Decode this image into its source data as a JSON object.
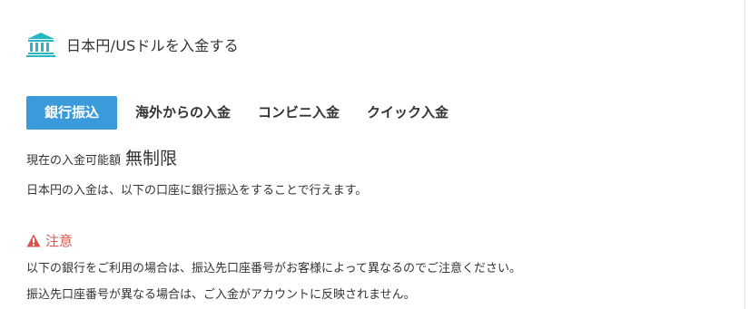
{
  "header": {
    "icon": "bank-icon",
    "icon_color": "#25b8c2",
    "title": "日本円/USドルを入金する"
  },
  "tabs": [
    {
      "label": "銀行振込",
      "active": true
    },
    {
      "label": "海外からの入金",
      "active": false
    },
    {
      "label": "コンビニ入金",
      "active": false
    },
    {
      "label": "クイック入金",
      "active": false
    }
  ],
  "accent_color": "#3b9ad9",
  "deposit_limit": {
    "label": "現在の入金可能額",
    "value": "無制限"
  },
  "info": {
    "text": "日本円の入金は、以下の口座に銀行振込をすることで行えます。"
  },
  "notice": {
    "icon": "warning-icon",
    "color": "#d9534f",
    "heading": "注意",
    "lines": [
      "以下の銀行をご利用の場合は、振込先口座番号がお客様によって異なるのでご注意ください。",
      "振込先口座番号が異なる場合は、ご入金がアカウントに反映されません。"
    ]
  }
}
